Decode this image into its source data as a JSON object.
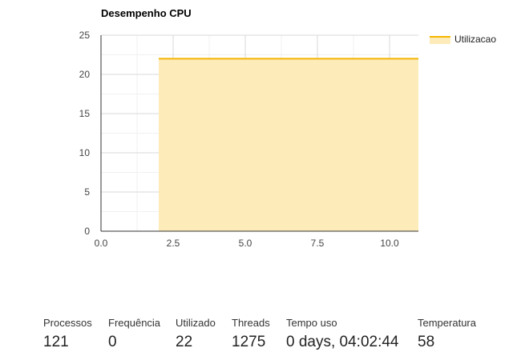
{
  "chart_data": {
    "type": "area",
    "title": "Desempenho CPU",
    "xlabel": "",
    "ylabel": "",
    "xlim": [
      0,
      11
    ],
    "ylim": [
      0,
      25
    ],
    "x_ticks": [
      "0.0",
      "2.5",
      "5.0",
      "7.5",
      "10.0"
    ],
    "y_ticks": [
      "0",
      "5",
      "10",
      "15",
      "20",
      "25"
    ],
    "grid": true,
    "legend_position": "right",
    "series": [
      {
        "name": "Utilizacao",
        "color": "#f4b400",
        "fill": "#fdebb9",
        "x": [
          2,
          3,
          4,
          5,
          6,
          7,
          8,
          9,
          10,
          11
        ],
        "values": [
          22,
          22,
          22,
          22,
          22,
          22,
          22,
          22,
          22,
          22
        ]
      }
    ]
  },
  "stats": [
    {
      "label": "Processos",
      "value": "121"
    },
    {
      "label": "Frequência",
      "value": "0"
    },
    {
      "label": "Utilizado",
      "value": "22"
    },
    {
      "label": "Threads",
      "value": "1275"
    },
    {
      "label": "Tempo uso",
      "value": "0 days, 04:02:44"
    },
    {
      "label": "Temperatura",
      "value": "58"
    }
  ]
}
